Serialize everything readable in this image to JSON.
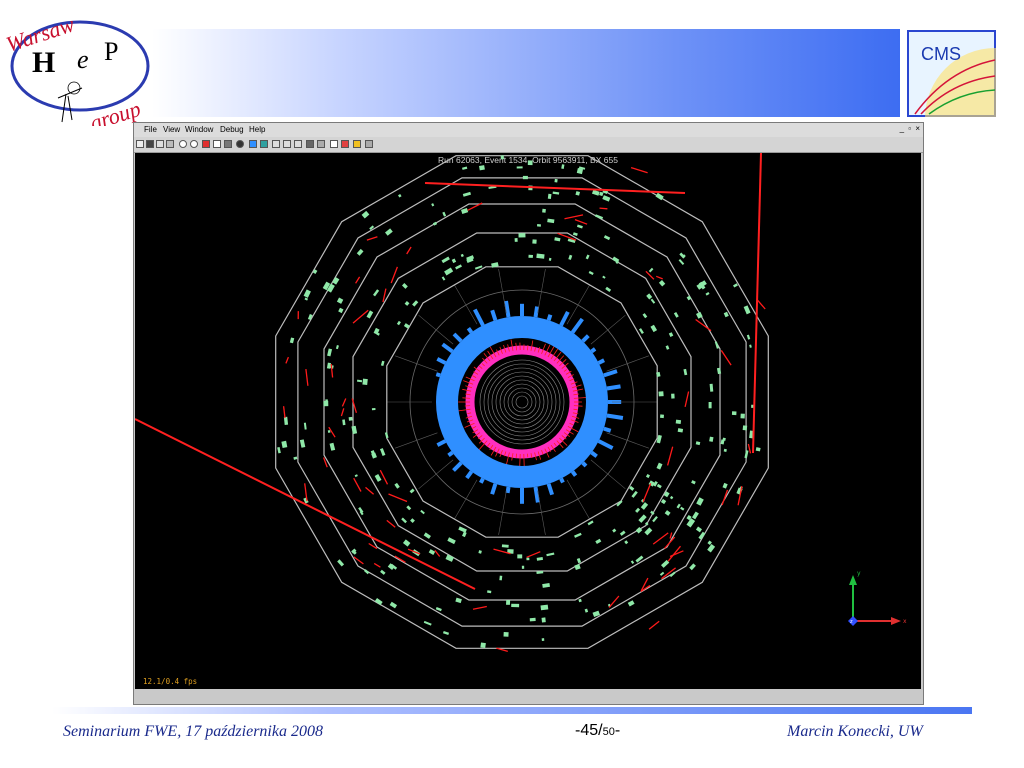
{
  "logo": {
    "warsaw": "Warsaw",
    "group": "group",
    "h": "H",
    "e": "e",
    "p": "P"
  },
  "cms_logo": {
    "text": "CMS"
  },
  "app": {
    "menu": [
      {
        "label": "File"
      },
      {
        "label": "View"
      },
      {
        "label": "Window"
      },
      {
        "label": "Debug"
      },
      {
        "label": "Help"
      }
    ],
    "window_controls": "_ ▫ ×",
    "run_info": "Run 62063, Event 1534, Orbit 9563911, BX 655",
    "fps": "12.1/0.4 fps",
    "axes": {
      "y": "y",
      "x": "x",
      "z": "z"
    }
  },
  "footer": {
    "left": "Seminarium FWE, 17 października 2008",
    "page_current": "-45/",
    "page_total": "50",
    "page_suffix": "-",
    "right": "Marcin Konecki,  UW"
  },
  "colors": {
    "header_blue": "#3d6df2",
    "footer_text": "#1a2a8c",
    "muon_red": "#ff1a1a",
    "hcal_blue": "#2f8fff",
    "ecal_magenta": "#ff2fbf",
    "chamber_green": "#8fe8a8"
  }
}
